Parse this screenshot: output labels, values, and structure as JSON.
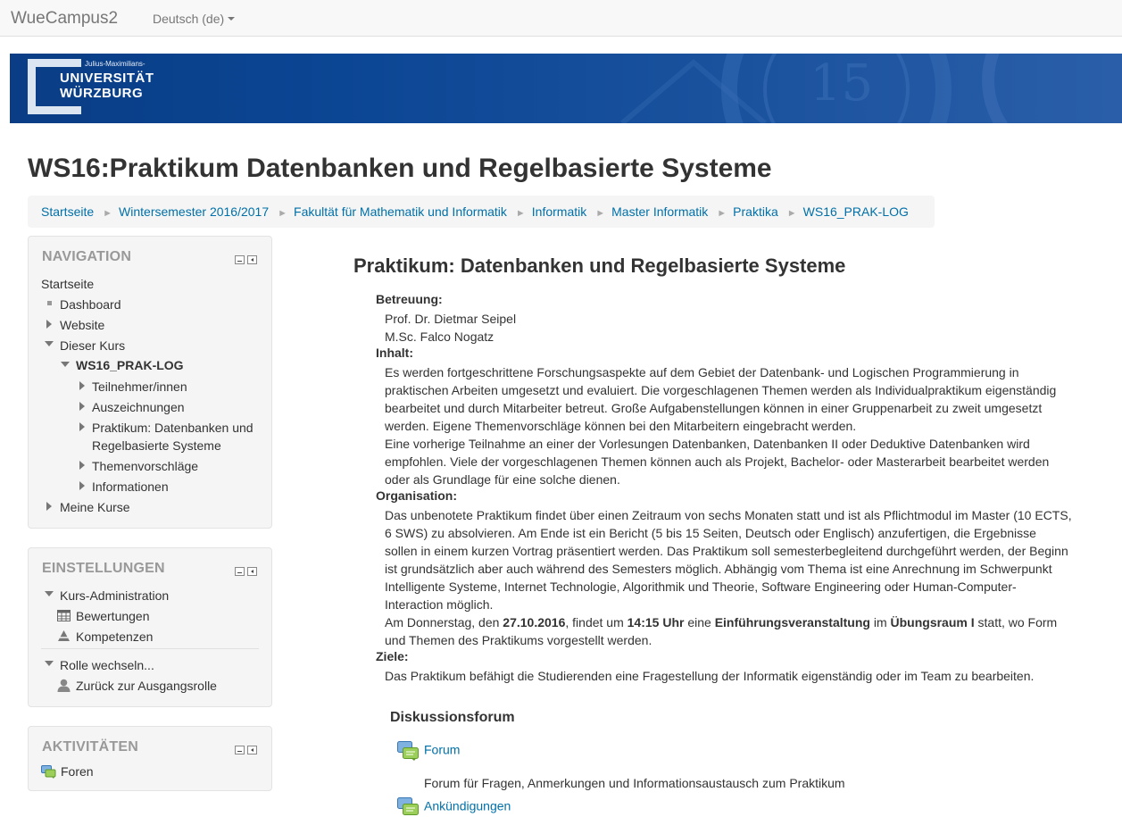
{
  "navbar": {
    "brand": "WueCampus2",
    "language": "Deutsch (de)"
  },
  "banner": {
    "logo_top": "Julius-Maximilians-",
    "logo_line1": "UNIVERSITÄT",
    "logo_line2": "WÜRZBURG",
    "deco_text": "15"
  },
  "page": {
    "title": "WS16:Praktikum Datenbanken und Regelbasierte Systeme"
  },
  "breadcrumb": [
    "Startseite",
    "Wintersemester 2016/2017",
    "Fakultät für Mathematik und Informatik",
    "Informatik",
    "Master Informatik",
    "Praktika",
    "WS16_PRAK-LOG"
  ],
  "navigation": {
    "title": "NAVIGATION",
    "home": "Startseite",
    "dashboard": "Dashboard",
    "website": "Website",
    "this_course": "Dieser Kurs",
    "course": "WS16_PRAK-LOG",
    "participants": "Teilnehmer/innen",
    "badges": "Auszeichnungen",
    "section_line1": "Praktikum: Datenbanken und",
    "section_line2": "Regelbasierte Systeme",
    "topics": "Themenvorschläge",
    "info": "Informationen",
    "my_courses": "Meine Kurse"
  },
  "settings": {
    "title": "EINSTELLUNGEN",
    "course_admin": "Kurs-Administration",
    "grades": "Bewertungen",
    "competencies": "Kompetenzen",
    "switch_role": "Rolle wechseln...",
    "return_role": "Zurück zur Ausgangsrolle"
  },
  "activities": {
    "title": "AKTIVITÄTEN",
    "forums": "Foren"
  },
  "main": {
    "heading": "Praktikum: Datenbanken und Regelbasierte Systeme",
    "betreuung_label": "Betreuung:",
    "supervisor1": "Prof. Dr. Dietmar Seipel",
    "supervisor2": "M.Sc. Falco Nogatz",
    "inhalt_label": "Inhalt:",
    "inhalt_p1": "Es werden fortgeschrittene Forschungsaspekte auf dem Gebiet der Datenbank- und Logischen Programmierung in praktischen Arbeiten umgesetzt und evaluiert. Die vorgeschlagenen Themen werden als Individualpraktikum eigenständig bearbeitet und durch Mitarbeiter betreut. Große Aufgabenstellungen können in einer Gruppenarbeit zu zweit umgesetzt werden. Eigene Themenvorschläge können bei den Mitarbeitern eingebracht werden.",
    "inhalt_p2": "Eine vorherige Teilnahme an einer der Vorlesungen Datenbanken, Datenbanken II oder Deduktive Datenbanken wird empfohlen. Viele der vorgeschlagenen Themen können auch als Projekt, Bachelor- oder Masterarbeit bearbeitet werden oder als Grundlage für eine solche dienen.",
    "organisation_label": "Organisation:",
    "org_p1": "Das unbenotete Praktikum findet über einen Zeitraum von sechs Monaten statt und ist als Pflichtmodul im Master (10 ECTS, 6 SWS) zu absolvieren. Am Ende ist ein Bericht (5 bis 15 Seiten, Deutsch oder Englisch) anzufertigen, die Ergebnisse sollen in einem kurzen Vortrag präsentiert werden. Das Praktikum soll semesterbegleitend durchgeführt werden, der Beginn ist grundsätzlich aber auch während des Semesters möglich. Abhängig vom Thema ist eine Anrechnung im Schwerpunkt Intelligente Systeme, Internet Technologie, Algorithmik und Theorie, Software Engineering oder Human-Computer-Interaction möglich.",
    "org_p2_a": "Am Donnerstag, den ",
    "org_p2_date": "27.10.2016",
    "org_p2_b": ", findet um ",
    "org_p2_time": "14:15 Uhr",
    "org_p2_c": " eine ",
    "org_p2_event": "Einführungsveranstaltung",
    "org_p2_d": " im ",
    "org_p2_room": "Übungsraum I",
    "org_p2_e": " statt, wo Form und Themen des Praktikums vorgestellt werden.",
    "ziele_label": "Ziele:",
    "ziele_p": "Das Praktikum befähigt die Studierenden eine Fragestellung der Informatik eigenständig oder im Team zu bearbeiten.",
    "forum_heading": "Diskussionsforum",
    "forum_link": "Forum",
    "forum_desc": "Forum für Fragen, Anmerkungen und Informationsaustausch zum Praktikum",
    "announcements_link": "Ankündigungen"
  }
}
